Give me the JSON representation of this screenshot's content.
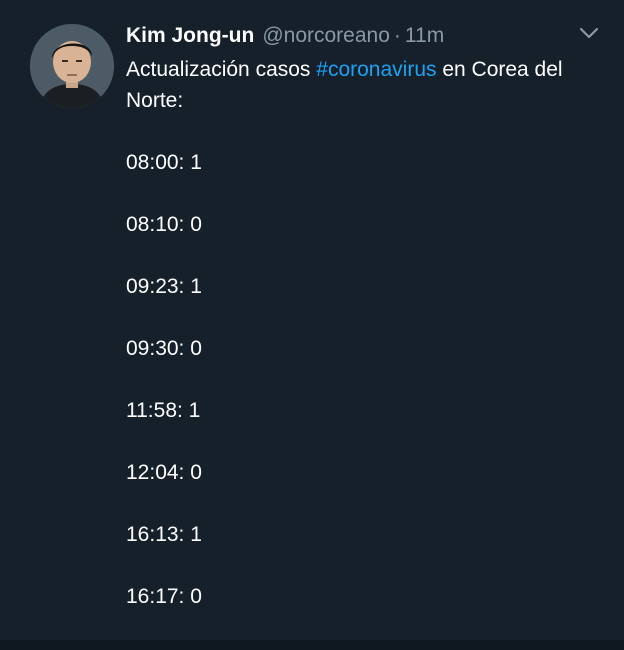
{
  "author": {
    "name": "Kim Jong-un",
    "handle": "@norcoreano",
    "separator": "·",
    "time": "11m",
    "avatar_icon": "profile-photo"
  },
  "tweet": {
    "text_before": "Actualización casos ",
    "hashtag": "#coronavirus",
    "text_after": " en Corea del Norte:",
    "updates": [
      "08:00: 1",
      "08:10: 0",
      "09:23: 1",
      "09:30: 0",
      "11:58: 1",
      "12:04: 0",
      "16:13: 1",
      "16:17: 0"
    ]
  },
  "menu": {
    "icon": "chevron-down-icon"
  },
  "colors": {
    "background": "#15202b",
    "text": "#ffffff",
    "muted": "#8899a6",
    "hashtag": "#1da1f2"
  }
}
